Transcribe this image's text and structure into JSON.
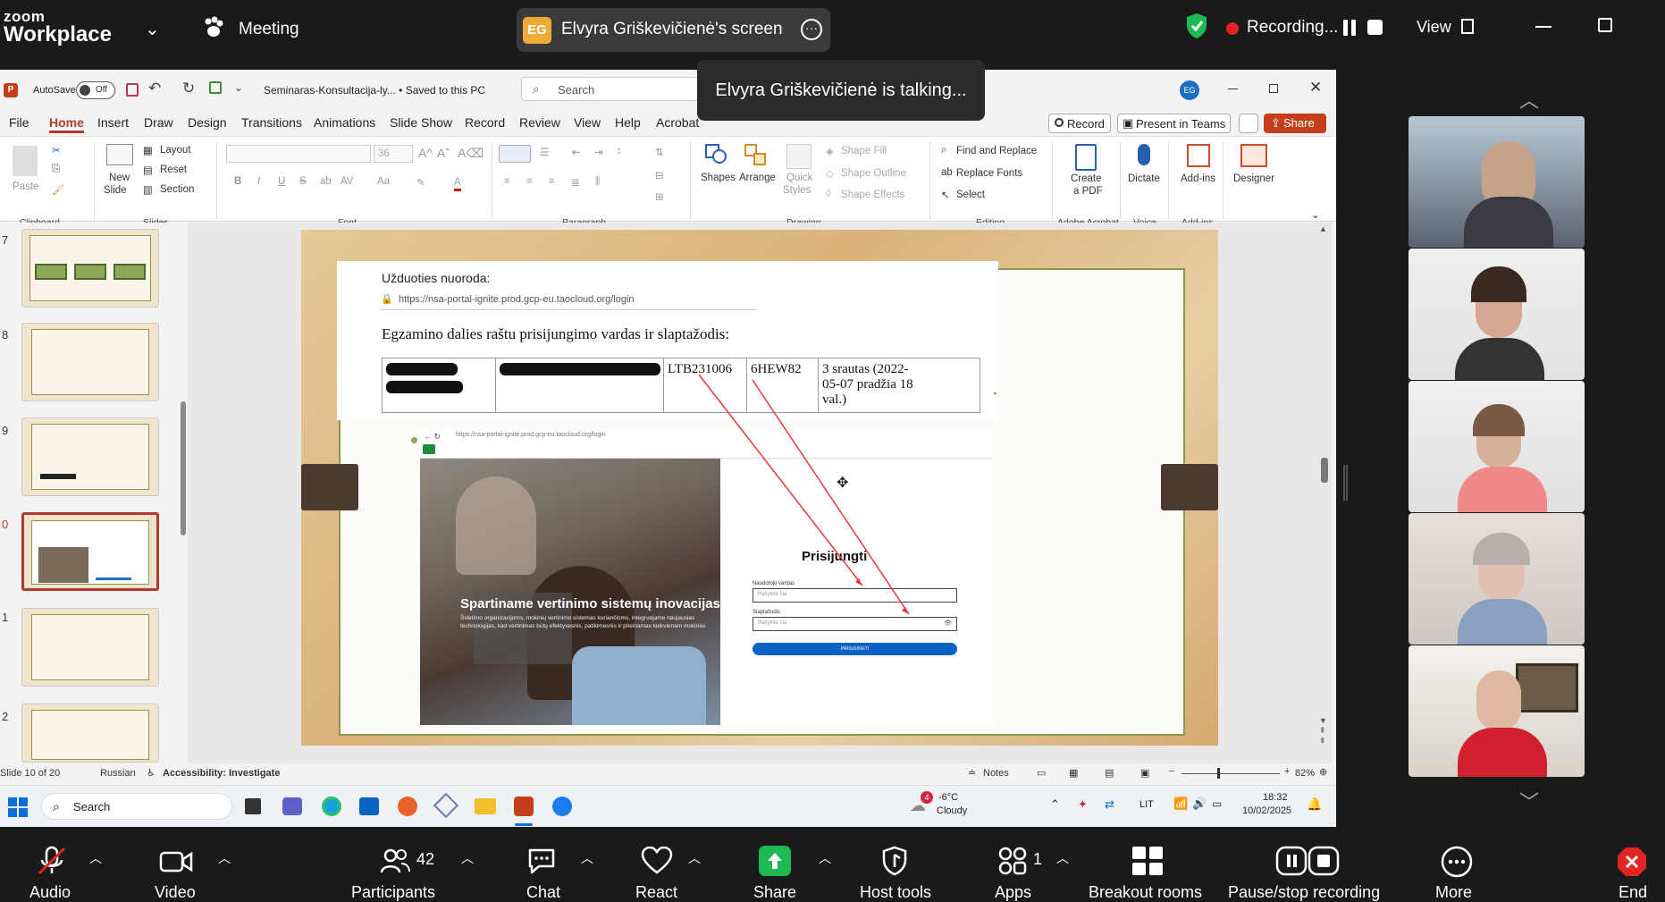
{
  "zoom": {
    "logo_top": "zoom",
    "logo_bottom": "Workplace",
    "meeting_label": "Meeting",
    "share_initials": "EG",
    "share_title": "Elvyra Griškevičienė's screen",
    "talking_toast": "Elvyra Griškevičienė is talking...",
    "recording_label": "Recording...",
    "view_label": "View",
    "toolbar": {
      "audio": "Audio",
      "video": "Video",
      "participants": "Participants",
      "participants_count": "42",
      "chat": "Chat",
      "react": "React",
      "share": "Share",
      "host_tools": "Host tools",
      "apps": "Apps",
      "apps_count": "1",
      "breakout": "Breakout rooms",
      "pause_recording": "Pause/stop recording",
      "more": "More",
      "end": "End"
    }
  },
  "ppt": {
    "autosave_label": "AutoSave",
    "autosave_state": "Off",
    "filename": "Seminaras-Konsultacija-ly... • Saved to this PC",
    "search_placeholder": "Search",
    "user_initials": "EG",
    "menu": [
      "File",
      "Home",
      "Insert",
      "Draw",
      "Design",
      "Transitions",
      "Animations",
      "Slide Show",
      "Record",
      "Review",
      "View",
      "Help",
      "Acrobat"
    ],
    "record_btn": "Record",
    "present_teams_btn": "Present in Teams",
    "share_btn": "Share",
    "ribbon": {
      "paste": "Paste",
      "clipboard": "Clipboard",
      "new_slide": "New",
      "new_slide2": "Slide",
      "layout": "Layout",
      "reset": "Reset",
      "section": "Section",
      "slides": "Slides",
      "font_size": "36",
      "font": "Font",
      "paragraph": "Paragraph",
      "shapes": "Shapes",
      "arrange": "Arrange",
      "quick_styles": "Quick",
      "quick_styles2": "Styles",
      "shape_fill": "Shape Fill",
      "shape_outline": "Shape Outline",
      "shape_effects": "Shape Effects",
      "drawing": "Drawing",
      "find_replace": "Find and Replace",
      "replace_fonts": "Replace Fonts",
      "select": "Select",
      "editing": "Editing",
      "create_pdf": "Create",
      "create_pdf2": "a PDF",
      "adobe_acrobat": "Adobe Acrobat",
      "dictate": "Dictate",
      "voice": "Voice",
      "addins": "Add-ins",
      "addins_group": "Add-ins",
      "designer": "Designer"
    },
    "thumb_numbers": [
      "7",
      "8",
      "9",
      "0",
      "1",
      "2"
    ],
    "slide": {
      "task_label": "Užduoties nuoroda:",
      "url": "https://nsa-portal-ignite.prod.gcp-eu.taocloud.org/login",
      "heading": "Egzamino dalies raštu prisijungimo vardas ir slaptažodis:",
      "table": [
        "LTB231006",
        "6HEW82",
        "3 srautas (2022-05-07 pradžia 18 val.)"
      ],
      "browser_url": "https://nsa-portal-ignite.prod.gcp-eu.taocloud.org/login",
      "hero_title": "Spartiname vertinimo sistemų inovacijas",
      "hero_text": "Švietimo organizacijoms, mokinių vertinimo sistemas kuriančioms, integruojame naujausias technologijas, kad vertinimas būtų efektyvesnis, patikimesnis ir prieinamas kiekvienam mokiniui.",
      "login_title": "Prisijungti",
      "username_label": "Naudotojo vardas",
      "username_placeholder": "Rašykite čia",
      "password_label": "Slaptažodis",
      "password_placeholder": "Rašykite čia",
      "login_button": "PRISIJUNGTI"
    },
    "status": {
      "slide_of": "Slide 10 of 20",
      "language": "Russian",
      "accessibility": "Accessibility: Investigate",
      "notes": "Notes",
      "zoom": "82%"
    },
    "taskbar": {
      "search": "Search",
      "weather_temp": "-6°C",
      "weather_desc": "Cloudy",
      "weather_badge": "4",
      "lang": "LIT",
      "time": "18:32",
      "date": "10/02/2025"
    }
  }
}
